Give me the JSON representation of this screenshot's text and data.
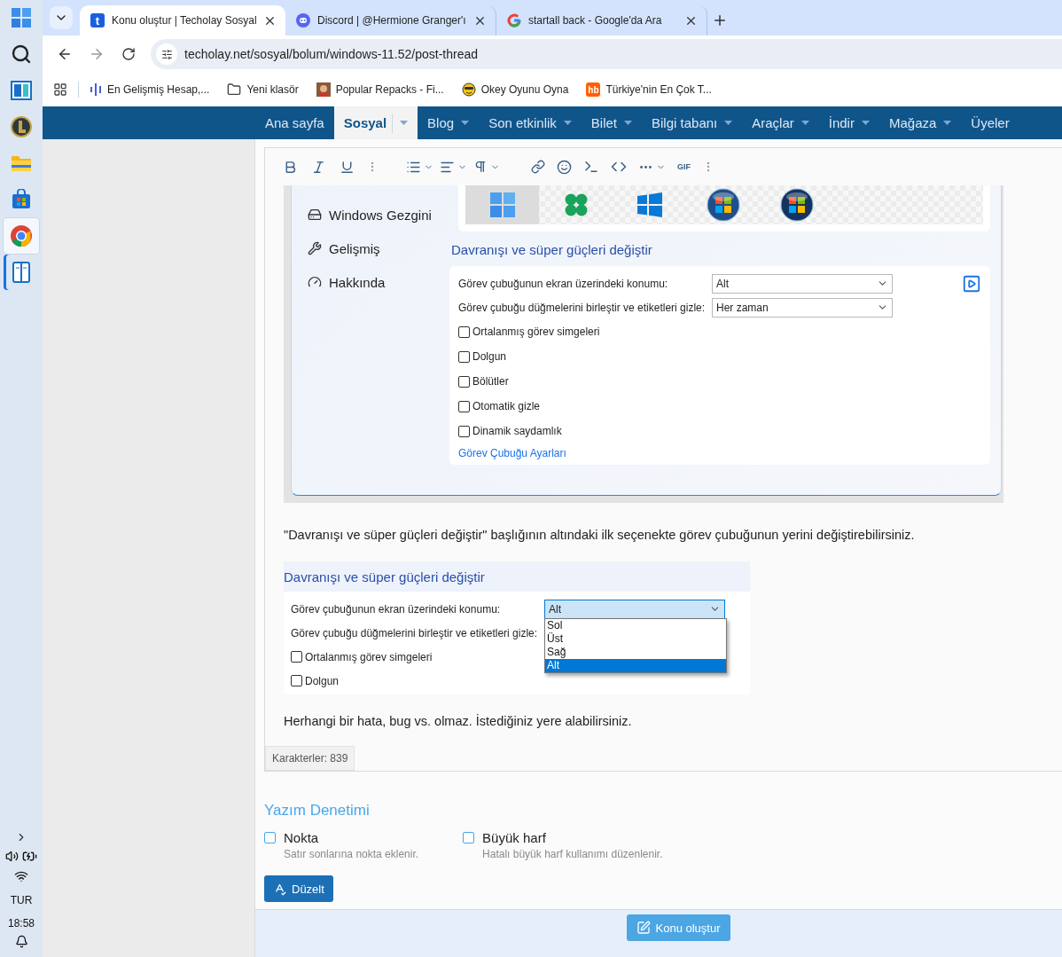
{
  "taskbar": {
    "apps": [
      {
        "kind": "start",
        "selected": false,
        "running": false
      },
      {
        "kind": "search",
        "selected": false,
        "running": false
      },
      {
        "kind": "widgets",
        "selected": false,
        "running": false
      },
      {
        "kind": "game",
        "selected": false,
        "running": false
      },
      {
        "kind": "files",
        "selected": false,
        "running": false
      },
      {
        "kind": "store",
        "selected": false,
        "running": false
      },
      {
        "kind": "browser",
        "selected": true,
        "running": false
      },
      {
        "kind": "reader",
        "selected": false,
        "running": true
      }
    ],
    "language": "TUR",
    "time": "18:58"
  },
  "browser": {
    "tabs": [
      {
        "kind": "techolay",
        "icon_text": "t",
        "title": "Konu oluştur | Techolay Sosyal",
        "selected": true
      },
      {
        "kind": "discord",
        "title": "Discord | @Hermione Granger'ı",
        "selected": false
      },
      {
        "kind": "google",
        "title": "startall back - Google'da Ara",
        "selected": false
      }
    ],
    "url": "techolay.net/sosyal/bolum/windows-11.52/post-thread",
    "bookmarks": [
      {
        "kind": "waveform",
        "label": "En Gelişmiş Hesap,..."
      },
      {
        "kind": "folder",
        "label": "Yeni klasör"
      },
      {
        "kind": "thumbnail",
        "label": "Popular Repacks - Fi..."
      },
      {
        "kind": "emoji",
        "label": "Okey Oyunu Oyna"
      },
      {
        "kind": "badge",
        "badge": "hb",
        "label": "Türkiye'nin En Çok T..."
      }
    ]
  },
  "site_nav": [
    {
      "label": "Ana sayfa",
      "selected": false,
      "has_menu": false
    },
    {
      "label": "Sosyal",
      "selected": true,
      "has_menu": true
    },
    {
      "label": "Blog",
      "selected": false,
      "has_menu": true
    },
    {
      "label": "Son etkinlik",
      "selected": false,
      "has_menu": true
    },
    {
      "label": "Bilet",
      "selected": false,
      "has_menu": true
    },
    {
      "label": "Bilgi tabanı",
      "selected": false,
      "has_menu": true
    },
    {
      "label": "Araçlar",
      "selected": false,
      "has_menu": true
    },
    {
      "label": "İndir",
      "selected": false,
      "has_menu": true
    },
    {
      "label": "Mağaza",
      "selected": false,
      "has_menu": true
    },
    {
      "label": "Üyeler",
      "selected": false,
      "has_menu": false
    }
  ],
  "editor": {
    "gif_label": "GIF",
    "screenshot_1": {
      "menu": [
        {
          "kind": "explorer",
          "label": "Windows Gezgini"
        },
        {
          "kind": "advanced",
          "label": "Gelişmiş"
        },
        {
          "kind": "about",
          "label": "Hakkında"
        }
      ],
      "start_styles": [
        {
          "kind": "win11",
          "selected": true
        },
        {
          "kind": "clover",
          "selected": false
        },
        {
          "kind": "win10",
          "selected": false
        },
        {
          "kind": "orb7",
          "selected": false
        },
        {
          "kind": "orbvista",
          "selected": false
        }
      ],
      "heading": "Davranışı ve süper güçleri değiştir",
      "settings": [
        {
          "kind": "select",
          "label": "Görev çubuğunun ekran üzerindeki konumu:",
          "value": "Alt"
        },
        {
          "kind": "select",
          "label": "Görev çubuğu düğmelerini birleştir ve etiketleri gizle:",
          "value": "Her zaman"
        },
        {
          "kind": "checkbox",
          "label": "Ortalanmış görev simgeleri",
          "checked": false
        },
        {
          "kind": "checkbox",
          "label": "Dolgun",
          "checked": false
        },
        {
          "kind": "checkbox",
          "label": "Bölütler",
          "checked": false
        },
        {
          "kind": "checkbox",
          "label": "Otomatik gizle",
          "checked": false
        },
        {
          "kind": "checkbox",
          "label": "Dinamik saydamlık",
          "checked": false
        }
      ],
      "link": "Görev Çubuğu Ayarları"
    },
    "paragraph_1": "\"Davranışı ve süper güçleri değiştir\" başlığının altındaki ilk seçenekte görev çubuğunun yerini değiştirebilirsiniz.",
    "screenshot_2": {
      "heading": "Davranışı ve süper güçleri değiştir",
      "settings": [
        {
          "kind": "select",
          "label": "Görev çubuğunun ekran üzerindeki konumu:",
          "value": "Alt",
          "open": true
        },
        {
          "kind": "label",
          "label": "Görev çubuğu düğmelerini birleştir ve etiketleri gizle:"
        },
        {
          "kind": "checkbox",
          "label": "Ortalanmış görev simgeleri",
          "checked": false
        },
        {
          "kind": "checkbox",
          "label": "Dolgun",
          "checked": false
        }
      ],
      "options": [
        {
          "label": "Sol",
          "selected": false
        },
        {
          "label": "Üst",
          "selected": false
        },
        {
          "label": "Sağ",
          "selected": false
        },
        {
          "label": "Alt",
          "selected": true
        }
      ]
    },
    "paragraph_2": "Herhangi bir hata, bug vs. olmaz. İstediğiniz yere alabilirsiniz.",
    "char_count": "Karakterler: 839"
  },
  "spellcheck": {
    "title": "Yazım Denetimi",
    "options": [
      {
        "label": "Nokta",
        "hint": "Satır sonlarına nokta eklenir.",
        "checked": false
      },
      {
        "label": "Büyük harf",
        "hint": "Hatalı büyük harf kullanımı düzenlenir.",
        "checked": false
      }
    ],
    "button": "Düzelt"
  },
  "submit": "Konu oluştur"
}
